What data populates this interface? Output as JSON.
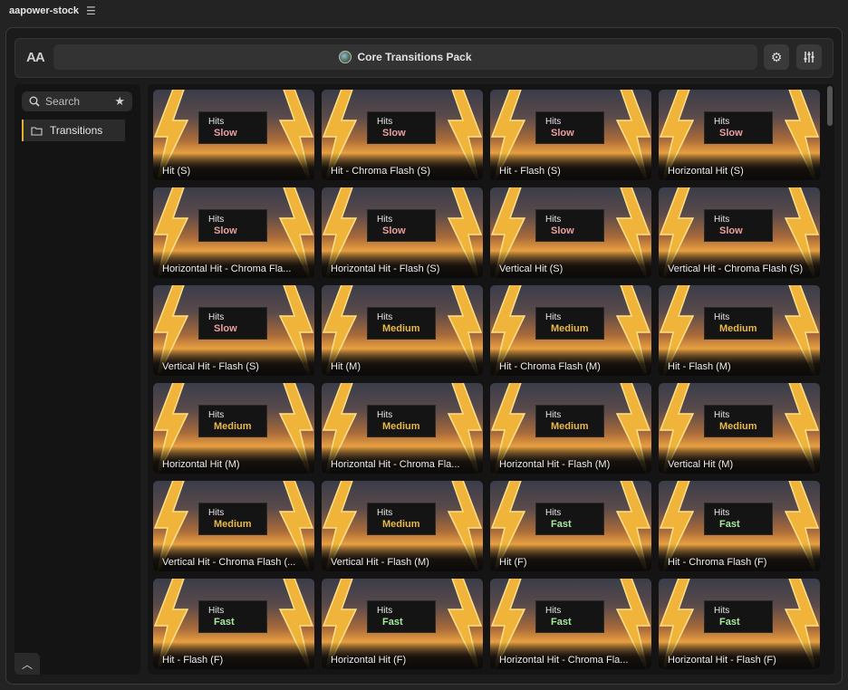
{
  "app": {
    "title": "aapower-stock",
    "menu_glyph": "☰"
  },
  "toolbar": {
    "aa_label": "AA",
    "pack_title": "Core Transitions Pack",
    "settings_glyph": "⚙",
    "sliders_glyph": "⧗"
  },
  "sidebar": {
    "search_label": "Search",
    "star_glyph": "★",
    "folder_label": "Transitions",
    "collapse_glyph": "︿"
  },
  "thumbnail": {
    "screen_title": "Hits"
  },
  "grid": {
    "items": [
      {
        "name": "Hit (S)",
        "speed": "Slow"
      },
      {
        "name": "Hit - Chroma Flash (S)",
        "speed": "Slow"
      },
      {
        "name": "Hit - Flash (S)",
        "speed": "Slow"
      },
      {
        "name": "Horizontal Hit (S)",
        "speed": "Slow"
      },
      {
        "name": "Horizontal Hit - Chroma Fla...",
        "speed": "Slow"
      },
      {
        "name": "Horizontal Hit - Flash (S)",
        "speed": "Slow"
      },
      {
        "name": "Vertical Hit (S)",
        "speed": "Slow"
      },
      {
        "name": "Vertical Hit - Chroma Flash (S)",
        "speed": "Slow"
      },
      {
        "name": "Vertical Hit - Flash (S)",
        "speed": "Slow"
      },
      {
        "name": "Hit (M)",
        "speed": "Medium"
      },
      {
        "name": "Hit - Chroma Flash (M)",
        "speed": "Medium"
      },
      {
        "name": "Hit - Flash (M)",
        "speed": "Medium"
      },
      {
        "name": "Horizontal Hit (M)",
        "speed": "Medium"
      },
      {
        "name": "Horizontal Hit - Chroma Fla...",
        "speed": "Medium"
      },
      {
        "name": "Horizontal Hit - Flash (M)",
        "speed": "Medium"
      },
      {
        "name": "Vertical Hit (M)",
        "speed": "Medium"
      },
      {
        "name": "Vertical Hit - Chroma Flash (...",
        "speed": "Medium"
      },
      {
        "name": "Vertical Hit - Flash (M)",
        "speed": "Medium"
      },
      {
        "name": "Hit (F)",
        "speed": "Fast"
      },
      {
        "name": "Hit - Chroma Flash (F)",
        "speed": "Fast"
      },
      {
        "name": "Hit - Flash (F)",
        "speed": "Fast"
      },
      {
        "name": "Horizontal Hit (F)",
        "speed": "Fast"
      },
      {
        "name": "Horizontal Hit - Chroma Fla...",
        "speed": "Fast"
      },
      {
        "name": "Horizontal Hit - Flash (F)",
        "speed": "Fast"
      }
    ]
  },
  "colors": {
    "slow": "#e8a0a0",
    "medium": "#e8b84a",
    "fast": "#a8e8a0",
    "accent": "#e0b030"
  }
}
